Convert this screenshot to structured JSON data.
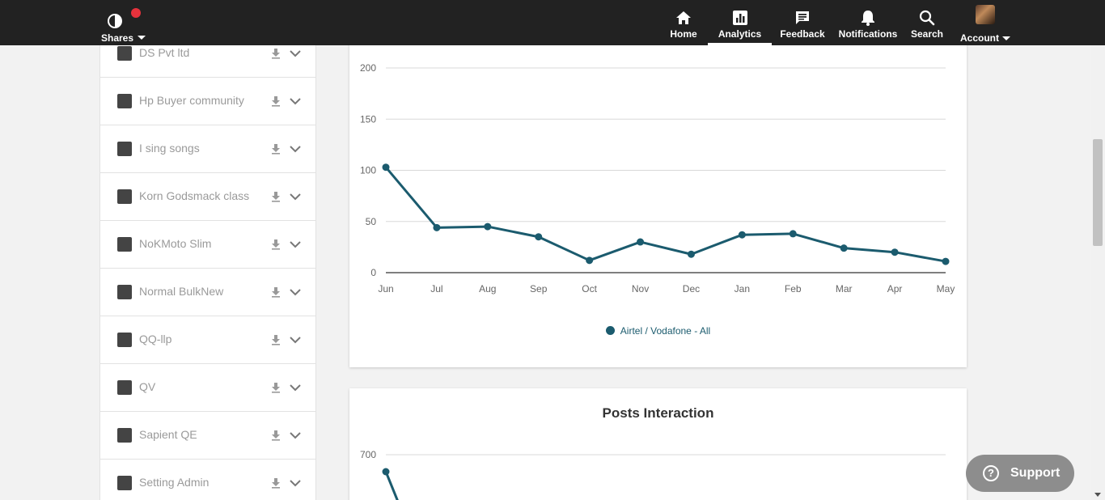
{
  "brand": {
    "label": "Shares"
  },
  "nav": [
    {
      "label": "Home",
      "icon": "home-icon"
    },
    {
      "label": "Analytics",
      "icon": "analytics-icon",
      "active": true
    },
    {
      "label": "Feedback",
      "icon": "feedback-icon"
    },
    {
      "label": "Notifications",
      "icon": "bell-icon"
    },
    {
      "label": "Search",
      "icon": "search-icon"
    },
    {
      "label": "Account",
      "icon": "avatar"
    }
  ],
  "sidebar": {
    "items": [
      {
        "label": "DS Pvt ltd"
      },
      {
        "label": "Hp Buyer community"
      },
      {
        "label": "I sing songs"
      },
      {
        "label": "Korn Godsmack class"
      },
      {
        "label": "NoKMoto Slim"
      },
      {
        "label": "Normal BulkNew"
      },
      {
        "label": "QQ-llp"
      },
      {
        "label": "QV"
      },
      {
        "label": "Sapient QE"
      },
      {
        "label": "Setting Admin"
      }
    ]
  },
  "chart1": {
    "legend": "Airtel / Vodafone - All"
  },
  "chart2": {
    "title": "Posts Interaction",
    "ytick_top": "700"
  },
  "support": {
    "label": "Support"
  },
  "colors": {
    "series": "#1b5b6e",
    "topbar": "#222222",
    "alert_dot": "#e6323c"
  },
  "chart_data": [
    {
      "type": "line",
      "title": "",
      "xlabel": "",
      "ylabel": "",
      "categories": [
        "Jun",
        "Jul",
        "Aug",
        "Sep",
        "Oct",
        "Nov",
        "Dec",
        "Jan",
        "Feb",
        "Mar",
        "Apr",
        "May"
      ],
      "series": [
        {
          "name": "Airtel / Vodafone - All",
          "values": [
            103,
            44,
            45,
            35,
            12,
            30,
            18,
            37,
            38,
            24,
            20,
            11
          ]
        }
      ],
      "ylim": [
        0,
        200
      ],
      "yticks": [
        0,
        50,
        100,
        150,
        200
      ],
      "grid": true,
      "legend": "bottom-center"
    },
    {
      "type": "line",
      "title": "Posts Interaction",
      "yticks_visible": [
        700
      ],
      "grid": true
    }
  ]
}
